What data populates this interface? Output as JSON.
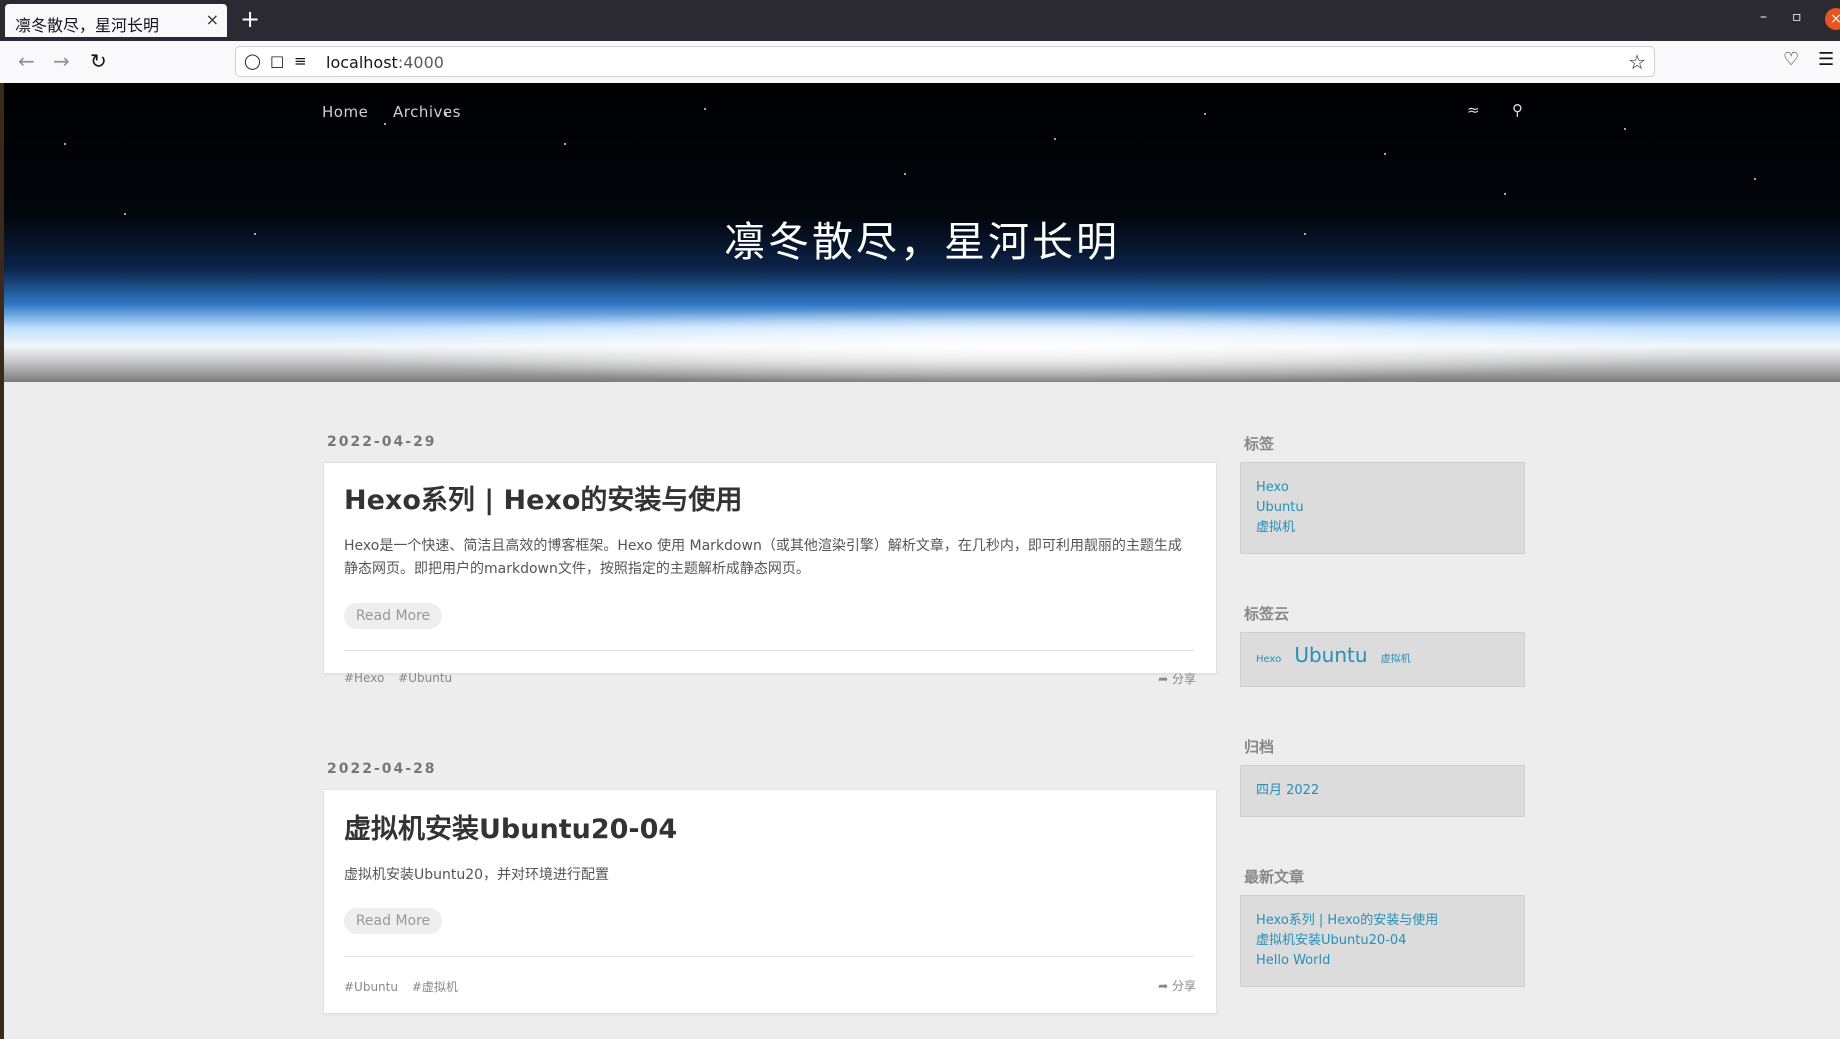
{
  "browser": {
    "tab_title": "凛冬散尽，星河长明",
    "tab_close": "×",
    "new_tab": "+",
    "url_host": "localhost",
    "url_port": ":4000",
    "win_minimize": "–",
    "win_restore": "▫",
    "win_close": "×"
  },
  "site": {
    "nav": [
      "Home",
      "Archives"
    ],
    "title": "凛冬散尽，星河长明"
  },
  "articles": [
    {
      "date": "2022-04-29",
      "title": "Hexo系列 | Hexo的安装与使用",
      "excerpt": "Hexo是一个快速、简洁且高效的博客框架。Hexo 使用 Markdown（或其他渲染引擎）解析文章，在几秒内，即可利用靓丽的主题生成静态网页。即把用户的markdown文件，按照指定的主题解析成静态网页。",
      "read_more": "Read More",
      "tags": [
        "#Hexo",
        "#Ubuntu"
      ],
      "share": "分享"
    },
    {
      "date": "2022-04-28",
      "title": "虚拟机安装Ubuntu20-04",
      "excerpt": "虚拟机安装Ubuntu20，并对环境进行配置",
      "read_more": "Read More",
      "tags": [
        "#Ubuntu",
        "#虚拟机"
      ],
      "share": "分享"
    }
  ],
  "sidebar": {
    "tags": {
      "title": "标签",
      "items": [
        "Hexo",
        "Ubuntu",
        "虚拟机"
      ]
    },
    "tag_cloud": {
      "title": "标签云",
      "items": [
        "Hexo",
        "Ubuntu",
        "虚拟机"
      ]
    },
    "archive": {
      "title": "归档",
      "items": [
        "四月 2022"
      ]
    },
    "recent": {
      "title": "最新文章",
      "items": [
        "Hexo系列 | Hexo的安装与使用",
        "虚拟机安装Ubuntu20-04",
        "Hello World"
      ]
    }
  },
  "colors": {
    "link": "#258fb8",
    "accent_close": "#e95420"
  }
}
